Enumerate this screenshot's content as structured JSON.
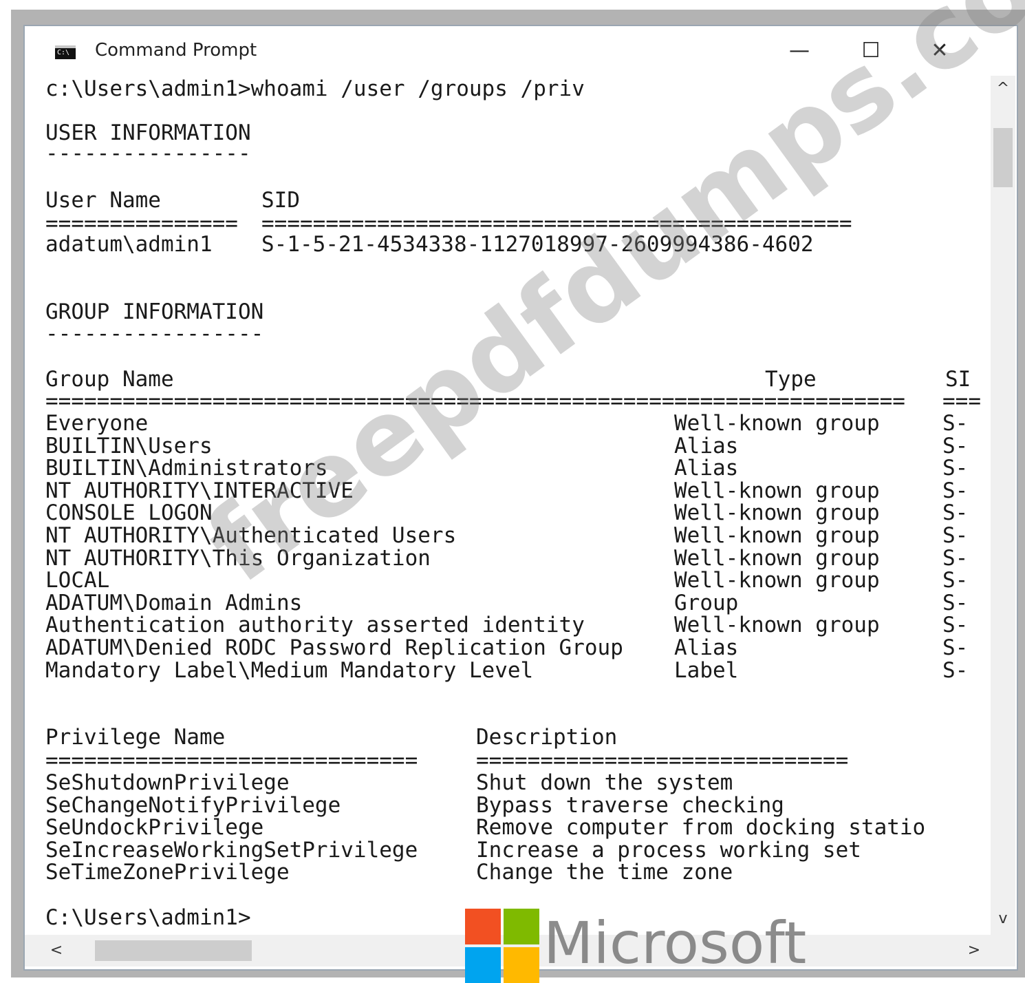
{
  "window": {
    "title": "Command Prompt",
    "icon": "cmd-icon",
    "controls": {
      "minimize": "—",
      "maximize": "☐",
      "close": "✕"
    }
  },
  "console": {
    "command_line": "c:\\Users\\admin1>whoami /user /groups /priv",
    "user_section": {
      "heading": "USER INFORMATION",
      "heading_rule": "----------------",
      "col_user": "User Name",
      "col_sid": "SID",
      "rule_user": "===============",
      "rule_sid": "==============================================",
      "user_name": "adatum\\admin1",
      "sid": "S-1-5-21-4534338-1127018997-2609994386-4602"
    },
    "group_section": {
      "heading": "GROUP INFORMATION",
      "heading_rule": "-----------------",
      "col_name": "Group Name",
      "col_type": "Type",
      "col_sid": "SI",
      "rule_name": "====================================================",
      "rule_type": "==================",
      "rule_sid": "===",
      "rows": [
        {
          "name": "Everyone",
          "type": "Well-known group",
          "sid": "S-"
        },
        {
          "name": "BUILTIN\\Users",
          "type": "Alias",
          "sid": "S-"
        },
        {
          "name": "BUILTIN\\Administrators",
          "type": "Alias",
          "sid": "S-"
        },
        {
          "name": "NT AUTHORITY\\INTERACTIVE",
          "type": "Well-known group",
          "sid": "S-"
        },
        {
          "name": "CONSOLE LOGON",
          "type": "Well-known group",
          "sid": "S-"
        },
        {
          "name": "NT AUTHORITY\\Authenticated Users",
          "type": "Well-known group",
          "sid": "S-"
        },
        {
          "name": "NT AUTHORITY\\This Organization",
          "type": "Well-known group",
          "sid": "S-"
        },
        {
          "name": "LOCAL",
          "type": "Well-known group",
          "sid": "S-"
        },
        {
          "name": "ADATUM\\Domain Admins",
          "type": "Group",
          "sid": "S-"
        },
        {
          "name": "Authentication authority asserted identity",
          "type": "Well-known group",
          "sid": "S-"
        },
        {
          "name": "ADATUM\\Denied RODC Password Replication Group",
          "type": "Alias",
          "sid": "S-"
        },
        {
          "name": "Mandatory Label\\Medium Mandatory Level",
          "type": "Label",
          "sid": "S-"
        }
      ]
    },
    "priv_section": {
      "col_name": "Privilege Name",
      "col_desc": "Description",
      "rule_name": "=============================",
      "rule_desc": "=============================",
      "rows": [
        {
          "name": "SeShutdownPrivilege",
          "desc": "Shut down the system"
        },
        {
          "name": "SeChangeNotifyPrivilege",
          "desc": "Bypass traverse checking"
        },
        {
          "name": "SeUndockPrivilege",
          "desc": "Remove computer from docking statio"
        },
        {
          "name": "SeIncreaseWorkingSetPrivilege",
          "desc": "Increase a process working set"
        },
        {
          "name": "SeTimeZonePrivilege",
          "desc": "Change the time zone"
        }
      ]
    },
    "prompt": "C:\\Users\\admin1>"
  },
  "scrollbars": {
    "up": "^",
    "down": "v",
    "left": "<",
    "right": ">"
  },
  "overlays": {
    "watermark": "freepdfdumps.com",
    "brand_text": "Microsoft",
    "brand_colors": [
      "#f25022",
      "#7fba00",
      "#00a4ef",
      "#ffb900"
    ]
  }
}
